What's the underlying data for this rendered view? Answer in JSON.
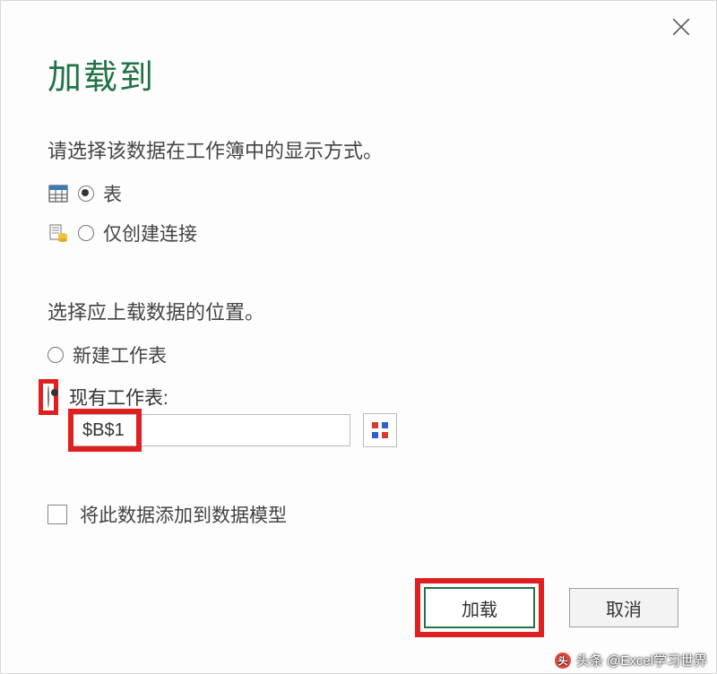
{
  "dialog": {
    "title": "加载到",
    "instruction_display": "请选择该数据在工作簿中的显示方式。",
    "option_table": "表",
    "option_connection": "仅创建连接",
    "instruction_location": "选择应上载数据的位置。",
    "option_new_sheet": "新建工作表",
    "option_existing_sheet": "现有工作表:",
    "cell_reference": "$B$1",
    "checkbox_model": "将此数据添加到数据模型",
    "button_load": "加载",
    "button_cancel": "取消"
  },
  "state": {
    "display_mode": "table",
    "location_mode": "existing",
    "add_to_model": false
  },
  "watermark": {
    "text": "头条 @Excel学习世界"
  },
  "colors": {
    "accent": "#217346",
    "highlight": "#e02020"
  }
}
